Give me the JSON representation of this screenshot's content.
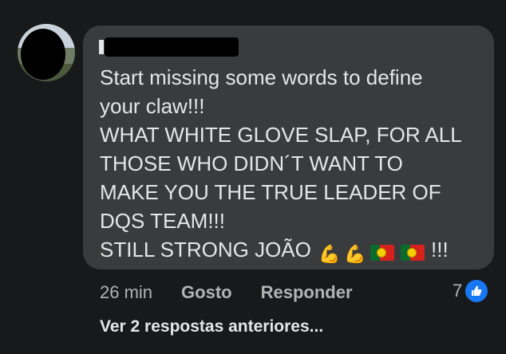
{
  "author": {
    "name_visible_initial": "F"
  },
  "comment": {
    "lines": [
      "Start missing some words to define",
      "your claw!!!",
      "WHAT WHITE GLOVE SLAP, FOR ALL",
      "THOSE WHO DIDN´T WANT TO",
      "MAKE YOU THE TRUE LEADER OF",
      "DQS TEAM!!!",
      "STILL STRONG JOÃO"
    ],
    "emoji": [
      "flexed-biceps",
      "flexed-biceps",
      "portugal-flag",
      "portugal-flag"
    ],
    "trailing_text": "!!!"
  },
  "actions": {
    "timestamp": "26 min",
    "like_label": "Gosto",
    "reply_label": "Responder"
  },
  "reactions": {
    "count": "7",
    "icon": "thumbs-up-icon",
    "color": "#1877f2"
  },
  "replies": {
    "label": "Ver 2 respostas anteriores..."
  },
  "colors": {
    "background": "#18191a",
    "bubble": "#3a3b3c",
    "text": "#e4e6eb",
    "muted": "#b0b3b8"
  }
}
